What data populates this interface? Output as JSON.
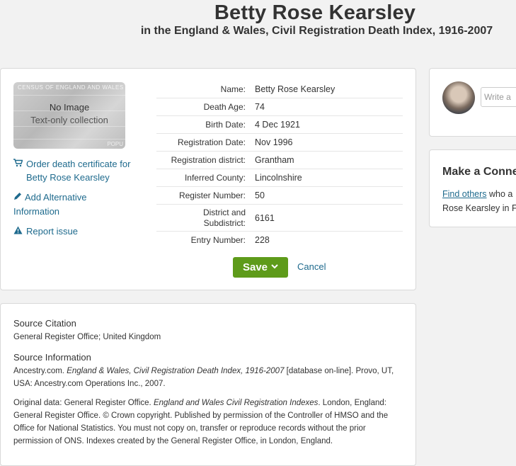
{
  "header": {
    "title": "Betty Rose Kearsley",
    "subtitle": "in the England & Wales, Civil Registration Death Index, 1916-2007"
  },
  "thumbnail": {
    "caption": "CENSUS OF ENGLAND AND WALES",
    "corner_text": "POPU",
    "no_image": "No Image",
    "text_only": "Text-only collection"
  },
  "side_links": {
    "order_certificate_line1": "Order death certificate for",
    "order_certificate_line2": "Betty Rose Kearsley",
    "add_alternative_line1": "Add Alternative",
    "add_alternative_line2": "Information",
    "report_issue": "Report issue"
  },
  "facts": [
    {
      "label": "Name:",
      "value": "Betty Rose Kearsley"
    },
    {
      "label": "Death Age:",
      "value": "74"
    },
    {
      "label": "Birth Date:",
      "value": "4 Dec 1921"
    },
    {
      "label": "Registration Date:",
      "value": "Nov 1996"
    },
    {
      "label": "Registration district:",
      "value": "Grantham"
    },
    {
      "label": "Inferred County:",
      "value": "Lincolnshire"
    },
    {
      "label": "Register Number:",
      "value": "50"
    },
    {
      "label": "District and Subdistrict:",
      "value": "6161"
    },
    {
      "label": "Entry Number:",
      "value": "228"
    }
  ],
  "actions": {
    "save_label": "Save",
    "cancel_label": "Cancel"
  },
  "right_panel": {
    "write_placeholder": "Write a",
    "connect_title": "Make a Conne",
    "find_others": "Find others",
    "connect_text_rest": " who a",
    "connect_text_line2": "Rose Kearsley in F"
  },
  "source": {
    "citation_heading": "Source Citation",
    "citation_text": "General Register Office; United Kingdom",
    "info_heading": "Source Information",
    "info_p1_a": "Ancestry.com. ",
    "info_p1_title": "England & Wales, Civil Registration Death Index, 1916-2007",
    "info_p1_b": " [database on-line]. Provo, UT, USA: Ancestry.com Operations Inc., 2007.",
    "info_p2_a": "Original data: General Register Office. ",
    "info_p2_title": "England and Wales Civil Registration Indexes",
    "info_p2_b": ". London, England: General Register Office. © Crown copyright. Published by permission of the Controller of HMSO and the Office for National Statistics. You must not copy on, transfer or reproduce records without the prior permission of ONS. Indexes created by the General Register Office, in London, England."
  },
  "colors": {
    "link": "#1e6a8d",
    "save_button": "#5e9b1a",
    "page_background": "#f2f2f2"
  },
  "icons": [
    "cart-icon",
    "pencil-icon",
    "warning-icon",
    "chevron-down-icon"
  ]
}
